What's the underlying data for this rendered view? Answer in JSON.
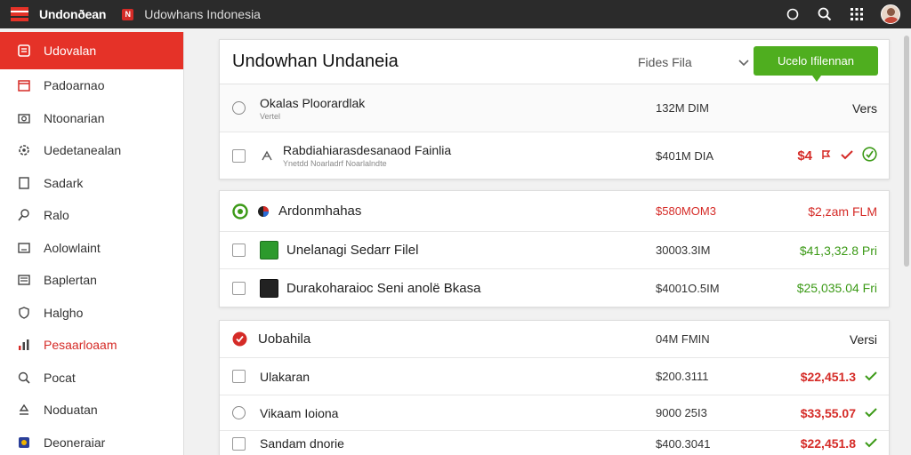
{
  "app": {
    "name": "Undonðean",
    "crumb": "Udowhans Indonesia"
  },
  "colors": {
    "accent_red": "#e53228",
    "accent_green": "#4fae1f",
    "topbar": "#2b2b2b"
  },
  "top_icons": [
    "circle-icon",
    "search-icon",
    "grid-icon",
    "avatar"
  ],
  "sidebar": {
    "items": [
      {
        "label": "Udovalan",
        "icon": "document-icon",
        "active": true
      },
      {
        "label": "Padoarnao",
        "icon": "calendar-icon"
      },
      {
        "label": "Ntoonarian",
        "icon": "camera-icon"
      },
      {
        "label": "Uedetanealan",
        "icon": "gear-icon"
      },
      {
        "label": "Sadark",
        "icon": "page-icon"
      },
      {
        "label": "Ralo",
        "icon": "search-icon"
      },
      {
        "label": "Aolowlaint",
        "icon": "monitor-icon"
      },
      {
        "label": "Baplertan",
        "icon": "list-icon"
      },
      {
        "label": "Halgho",
        "icon": "shield-icon"
      },
      {
        "label": "Pesaarloaam",
        "icon": "bars-icon",
        "red": true
      },
      {
        "label": "Pocat",
        "icon": "search-icon"
      },
      {
        "label": "Noduatan",
        "icon": "upload-icon"
      },
      {
        "label": "Deoneraiar",
        "icon": "app-icon"
      }
    ]
  },
  "main": {
    "title": "Undowhan Undaneia",
    "filter_label": "Fides Fila",
    "primary_button": "Ucelo Ifilennan",
    "panel1": {
      "group": {
        "name": "Okalas Ploorardlak",
        "sub": "Vertel",
        "mid": "132M DIM",
        "right": "Vers"
      },
      "rows": [
        {
          "name": "Rabdiahiarasdesanaod Fainlia",
          "sub": "Ynetdd Noarladrf Noarlalndte",
          "mid": "$401M DIA",
          "right": "$4"
        }
      ]
    },
    "panel2": {
      "group": {
        "name": "Ardonmhahas",
        "mid": "$580MOM3",
        "right": "$2,zam FLM"
      },
      "rows": [
        {
          "name": "Unelanagi Sedarr Filel",
          "mid": "30003.3IM",
          "right": "$41,3,32.8 Pri"
        },
        {
          "name": "Durakoharaioc Seni anolë Bkasa",
          "mid": "$4001O.5IM",
          "right": "$25,035.04 Fri"
        }
      ]
    },
    "panel3": {
      "group": {
        "name": "Uobahila",
        "mid": "04M FMIN",
        "right": "Versi"
      },
      "rows": [
        {
          "name": "Ulakaran",
          "mid": "$200.3111",
          "right": "$22,451.3"
        },
        {
          "name": "Vikaam Ioiona",
          "mid": "9000 25I3",
          "right": "$33,55.07"
        },
        {
          "name": "Sandam dnorie",
          "mid": "$400.3041",
          "right": "$22,451.8"
        }
      ]
    }
  }
}
